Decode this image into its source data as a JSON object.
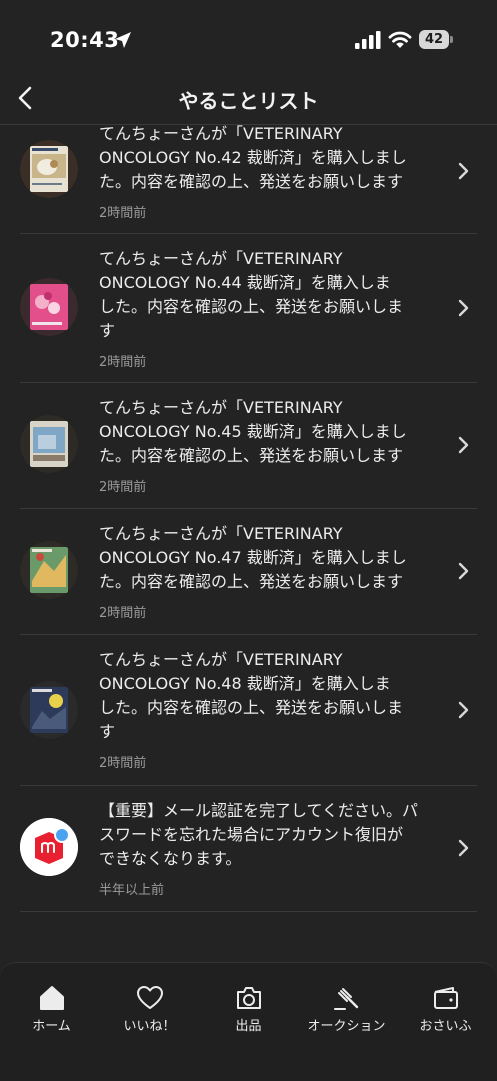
{
  "status_bar": {
    "time": "20:43",
    "battery": "42"
  },
  "header": {
    "title": "やることリスト"
  },
  "items": [
    {
      "lines": "てんちょーさんが「VETERINARY\nONCOLOGY No.42 裁断済」を購入しまし\nた。内容を確認の上、発送をお願いします",
      "timestamp": "2時間前"
    },
    {
      "lines": "てんちょーさんが「VETERINARY\nONCOLOGY No.44 裁断済」を購入しま\nした。内容を確認の上、発送をお願いしま\nす",
      "timestamp": "2時間前"
    },
    {
      "lines": "てんちょーさんが「VETERINARY\nONCOLOGY No.45 裁断済」を購入しまし\nた。内容を確認の上、発送をお願いします",
      "timestamp": "2時間前"
    },
    {
      "lines": "てんちょーさんが「VETERINARY\nONCOLOGY No.47 裁断済」を購入しまし\nた。内容を確認の上、発送をお願いします",
      "timestamp": "2時間前"
    },
    {
      "lines": "てんちょーさんが「VETERINARY\nONCOLOGY No.48 裁断済」を購入しま\nした。内容を確認の上、発送をお願いしま\nす",
      "timestamp": "2時間前"
    },
    {
      "lines": "【重要】メール認証を完了してください。パ\nスワードを忘れた場合にアカウント復旧が\nできなくなります。",
      "timestamp": "半年以上前"
    }
  ],
  "tabs": [
    {
      "label": "ホーム",
      "icon": "home-icon"
    },
    {
      "label": "いいね！",
      "icon": "heart-icon"
    },
    {
      "label": "出品",
      "icon": "camera-icon"
    },
    {
      "label": "オークション",
      "icon": "gavel-icon"
    },
    {
      "label": "おさいふ",
      "icon": "wallet-icon"
    }
  ],
  "colors": {
    "background": "#232323",
    "logo_red": "#e8202f",
    "logo_dot": "#4aa3f0"
  }
}
